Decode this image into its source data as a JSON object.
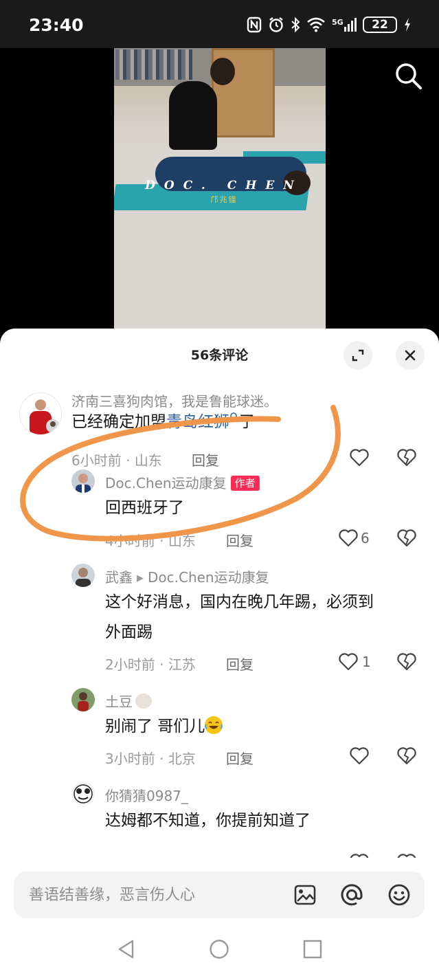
{
  "status_bar": {
    "time": "23:40",
    "icons": [
      "nfc-icon",
      "alarm-icon",
      "bluetooth-icon",
      "wifi-icon",
      "signal-5g-icon",
      "battery-icon",
      "charging-icon"
    ],
    "network": "5G",
    "battery_level": "22"
  },
  "video": {
    "overlay_logo": "DOC. CHEN",
    "overlay_sub": "邝兆镭"
  },
  "comments_panel": {
    "title": "56条评论",
    "comments": [
      {
        "user": "济南三喜狗肉馆，我是鲁能球迷。",
        "text_before": "已经确定加盟",
        "link": "青岛红狮",
        "text_after": "了",
        "time": "6小时前",
        "location": "山东",
        "reply_label": "回复",
        "likes": ""
      },
      {
        "user": "Doc.Chen运动康复",
        "badge": "作者",
        "text": "回西班牙了",
        "time": "4小时前",
        "location": "山东",
        "reply_label": "回复",
        "likes": "6"
      },
      {
        "user": "武鑫",
        "reply_to": "Doc.Chen运动康复",
        "text_line1": "这个好消息，国内在晚几年踢，必须到",
        "text_line2": "外面踢",
        "time": "2小时前",
        "location": "江苏",
        "reply_label": "回复",
        "likes": "1"
      },
      {
        "user": "土豆",
        "text": "别闹了 哥们儿",
        "time": "3小时前",
        "location": "北京",
        "reply_label": "回复",
        "likes": ""
      },
      {
        "user": "你猜猜0987_",
        "text": "达姆都不知道，你提前知道了",
        "time": "",
        "location": "",
        "reply_label": "",
        "likes": ""
      }
    ],
    "meta_separator": "·"
  },
  "input": {
    "placeholder": "善语结善缘，恶言伤人心"
  },
  "colors": {
    "accent_red": "#fe2c55",
    "link_blue": "#2f5f9e",
    "annotation_orange": "#f0964a"
  }
}
